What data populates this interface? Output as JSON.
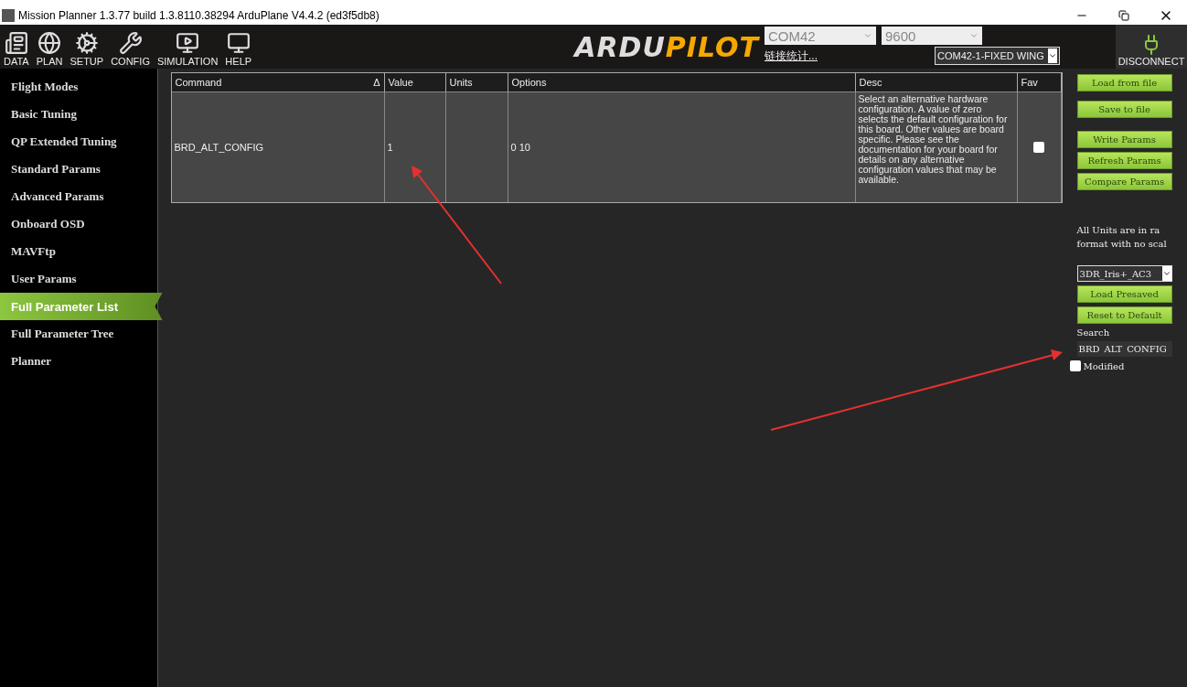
{
  "window": {
    "title": "Mission Planner 1.3.77 build 1.3.8110.38294 ArduPlane V4.4.2 (ed3f5db8)"
  },
  "toolbar": {
    "items": [
      {
        "label": "DATA"
      },
      {
        "label": "PLAN"
      },
      {
        "label": "SETUP"
      },
      {
        "label": "CONFIG"
      },
      {
        "label": "SIMULATION"
      },
      {
        "label": "HELP"
      }
    ],
    "logo": {
      "first": "ARDU",
      "second": "PILOT"
    },
    "port": "COM42",
    "baud": "9600",
    "link_stats": "链接统计...",
    "vehicle": "COM42-1-FIXED WING",
    "connect_label": "DISCONNECT"
  },
  "sidebar": {
    "items": [
      {
        "label": "Flight Modes",
        "selected": false
      },
      {
        "label": "Basic Tuning",
        "selected": false
      },
      {
        "label": "QP Extended Tuning",
        "selected": false
      },
      {
        "label": "Standard Params",
        "selected": false
      },
      {
        "label": "Advanced Params",
        "selected": false
      },
      {
        "label": "Onboard OSD",
        "selected": false
      },
      {
        "label": "MAVFtp",
        "selected": false
      },
      {
        "label": "User Params",
        "selected": false
      },
      {
        "label": "Full Parameter List",
        "selected": true
      },
      {
        "label": "Full Parameter Tree",
        "selected": false
      },
      {
        "label": "Planner",
        "selected": false
      }
    ]
  },
  "table": {
    "columns": [
      {
        "label": "Command",
        "sort_mark": "Δ"
      },
      {
        "label": "Value"
      },
      {
        "label": "Units"
      },
      {
        "label": "Options"
      },
      {
        "label": "Desc"
      },
      {
        "label": "Fav"
      }
    ],
    "rows": [
      {
        "command": "BRD_ALT_CONFIG",
        "value": "1",
        "options": "0 10",
        "desc": "Select an alternative hardware configuration. A value of zero selects the default configuration for this board. Other values are board specific. Please see the documentation for your board for details on any alternative configuration values that may be available.",
        "fav": false
      }
    ]
  },
  "panel": {
    "buttons": [
      "Load from file",
      "Save to file",
      "Write Params",
      "Refresh Params",
      "Compare Params"
    ],
    "note": [
      "All Units are in ra",
      "format with no scal"
    ],
    "preset": "3DR_Iris+_AC3",
    "preset_buttons": [
      "Load Presaved",
      "Reset to Default"
    ],
    "search_label": "Search",
    "search_value": "BRD_ALT_CONFIG",
    "modified": {
      "label": "Modified",
      "checked": false
    }
  }
}
